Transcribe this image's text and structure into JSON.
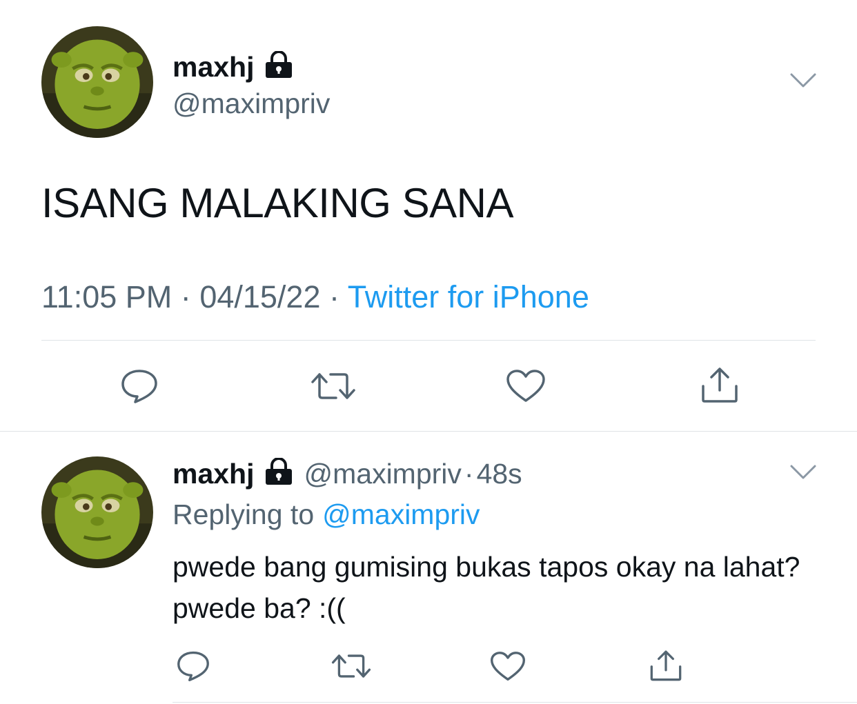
{
  "main_tweet": {
    "display_name": "maxhj",
    "handle": "@maximpriv",
    "text": "ISANG MALAKING SANA",
    "time": "11:05 PM",
    "separator1": "·",
    "date": "04/15/22",
    "separator2": "·",
    "source": "Twitter for iPhone"
  },
  "reply_tweet": {
    "display_name": "maxhj",
    "handle": "@maximpriv",
    "separator": "·",
    "age": "48s",
    "replying_prefix": "Replying to",
    "replying_to": "@maximpriv",
    "text": "pwede bang gumising bukas tapos okay na lahat? pwede ba? :(("
  },
  "icons": {
    "verified_lock": "lock-icon",
    "menu": "chevron-down-icon",
    "reply": "comment-icon",
    "retweet": "retweet-icon",
    "like": "heart-icon",
    "share": "share-icon"
  },
  "colors": {
    "text": "#0f1419",
    "secondary": "#536471",
    "link": "#1d9bf0",
    "divider": "#dfe3e6",
    "avatar_green": "#7a9a1e"
  }
}
